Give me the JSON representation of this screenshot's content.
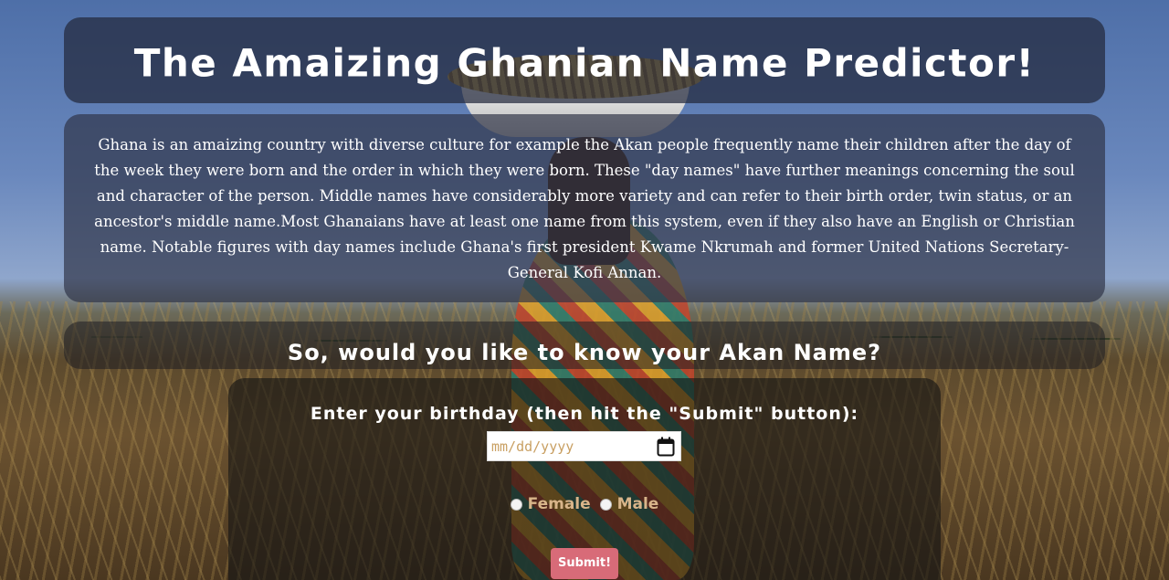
{
  "header": {
    "title": "The Amaizing Ghanian Name Predictor!"
  },
  "intro": {
    "text": "Ghana is an amaizing country with diverse culture for example the Akan people frequently name their children after the day of the week they were born and the order in which they were born. These \"day names\" have further meanings concerning the soul and character of the person. Middle names have considerably more variety and can refer to their birth order, twin status, or an ancestor's middle name.Most Ghanaians have at least one name from this system, even if they also have an English or Christian name. Notable figures with day names include Ghana's first president Kwame Nkrumah and former United Nations Secretary-General Kofi Annan."
  },
  "question": {
    "text": "So, would you like to know your Akan Name?"
  },
  "form": {
    "birthday_label": "Enter your birthday (then hit the \"Submit\" button):",
    "date_placeholder": "mm/dd/yyyy",
    "date_icon": "calendar-icon",
    "gender_options": [
      "Female",
      "Male"
    ],
    "submit_label": "Submit!"
  },
  "colors": {
    "panel_bg": "#23283c",
    "submit_bg": "#d86b78",
    "radio_label": "#d8b58a",
    "placeholder": "#c9a063"
  }
}
